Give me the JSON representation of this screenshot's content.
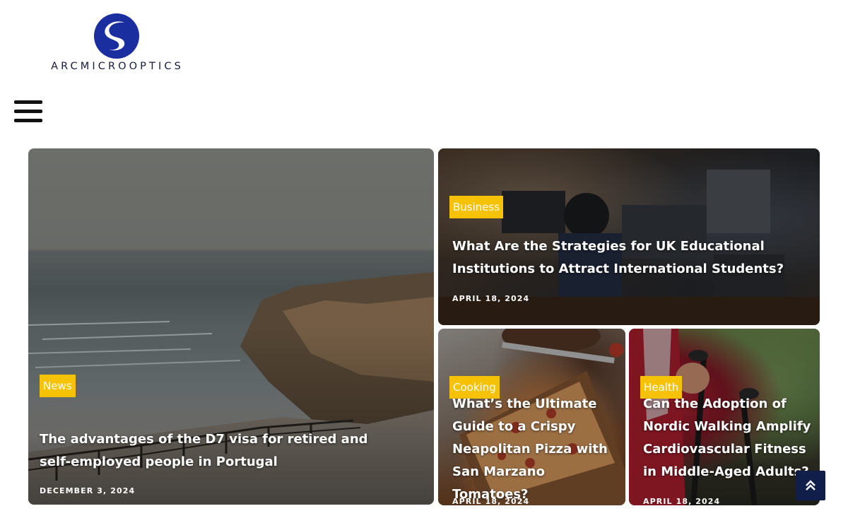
{
  "brand": {
    "name": "ARCMICROOPTICS",
    "logo_icon": "s-swoosh-logo",
    "color": "#1a2ea0"
  },
  "nav": {
    "menu_icon": "hamburger-icon"
  },
  "posts": [
    {
      "category": "News",
      "title": "The advantages of the D7 visa for retired and self-employed people in Portugal",
      "date": "DECEMBER 3, 2024",
      "image": "coastal-cliff-seascape"
    },
    {
      "category": "Business",
      "title": "What Are the Strategies for UK Educational Institutions to Attract International Students?",
      "date": "APRIL 18, 2024",
      "image": "students-working-on-laptops"
    },
    {
      "category": "Cooking",
      "title": "What’s the Ultimate Guide to a Crispy Neapolitan Pizza with San Marzano Tomatoes?",
      "date": "APRIL 18, 2024",
      "image": "pizza-on-board"
    },
    {
      "category": "Health",
      "title": "Can the Adoption of Nordic Walking Amplify Cardiovascular Fitness in Middle-Aged Adults?",
      "date": "APRIL 18, 2024",
      "image": "nordic-walking-poles"
    }
  ],
  "colors": {
    "badge": "#f5c206",
    "scroll_top_button": "#0f1f4a"
  },
  "scroll_top_icon": "double-chevron-up-icon"
}
